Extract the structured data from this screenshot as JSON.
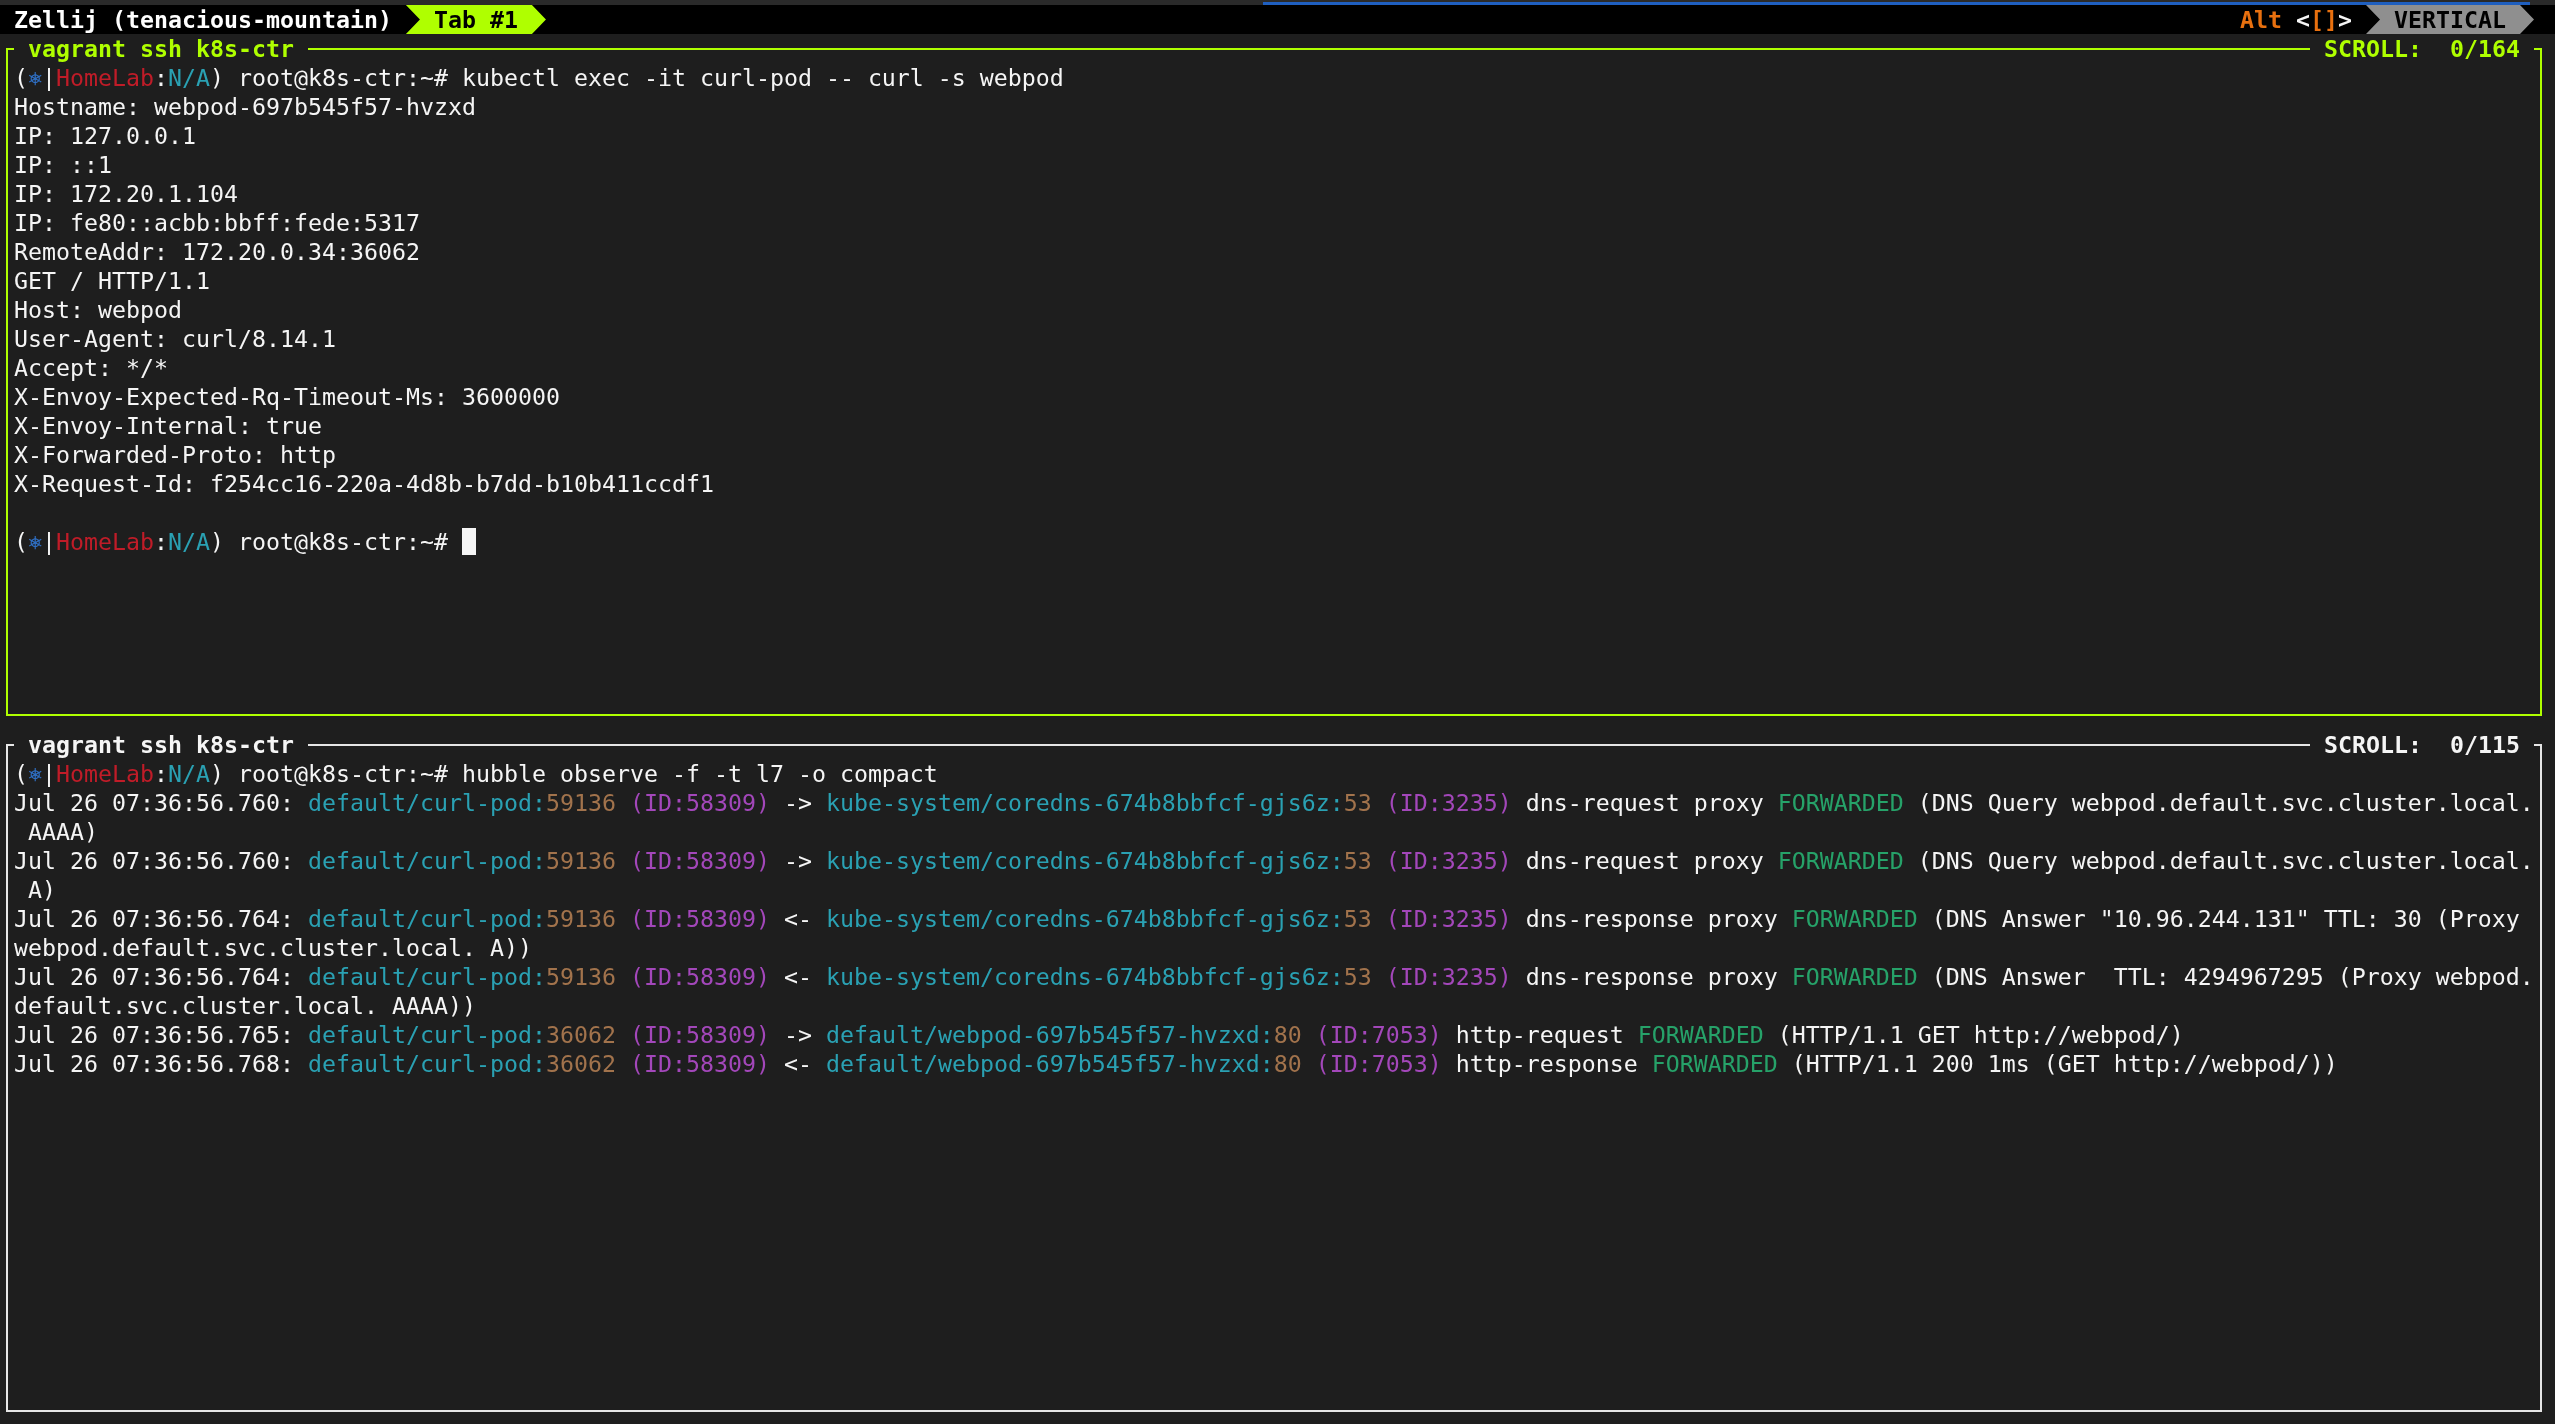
{
  "tab_bar": {
    "session": "Zellij (tenacious-mountain)",
    "tabs": [
      {
        "label": "Tab #1",
        "selected": true
      }
    ],
    "mode_hint": [
      {
        "text": "Alt",
        "kind": "key"
      },
      {
        "text": " <",
        "kind": "plain"
      },
      {
        "text": "[]",
        "kind": "key"
      },
      {
        "text": ">",
        "kind": "plain"
      }
    ],
    "layout": "VERTICAL"
  },
  "panes": [
    {
      "title": "vagrant ssh k8s-ctr",
      "scroll": "SCROLL:  0/164",
      "focused": true,
      "cursor": true,
      "lines": [
        {
          "kind": "prompt",
          "segments": [
            {
              "text": "(",
              "kind": "plain"
            },
            {
              "text": "⎈",
              "kind": "helm"
            },
            {
              "text": "|",
              "kind": "plain"
            },
            {
              "text": "HomeLab",
              "kind": "cluster"
            },
            {
              "text": ":",
              "kind": "plain"
            },
            {
              "text": "N/A",
              "kind": "namespace"
            },
            {
              "text": ") root@k8s-ctr:~# kubectl exec -it curl-pod -- curl -s webpod",
              "kind": "plain"
            }
          ]
        },
        {
          "kind": "output",
          "text": "Hostname: webpod-697b545f57-hvzxd"
        },
        {
          "kind": "output",
          "text": "IP: 127.0.0.1"
        },
        {
          "kind": "output",
          "text": "IP: ::1"
        },
        {
          "kind": "output",
          "text": "IP: 172.20.1.104"
        },
        {
          "kind": "output",
          "text": "IP: fe80::acbb:bbff:fede:5317"
        },
        {
          "kind": "output",
          "text": "RemoteAddr: 172.20.0.34:36062"
        },
        {
          "kind": "output",
          "text": "GET / HTTP/1.1"
        },
        {
          "kind": "output",
          "text": "Host: webpod"
        },
        {
          "kind": "output",
          "text": "User-Agent: curl/8.14.1"
        },
        {
          "kind": "output",
          "text": "Accept: */*"
        },
        {
          "kind": "output",
          "text": "X-Envoy-Expected-Rq-Timeout-Ms: 3600000"
        },
        {
          "kind": "output",
          "text": "X-Envoy-Internal: true"
        },
        {
          "kind": "output",
          "text": "X-Forwarded-Proto: http"
        },
        {
          "kind": "output",
          "text": "X-Request-Id: f254cc16-220a-4d8b-b7dd-b10b411ccdf1"
        },
        {
          "kind": "blank"
        },
        {
          "kind": "prompt",
          "segments": [
            {
              "text": "(",
              "kind": "plain"
            },
            {
              "text": "⎈",
              "kind": "helm"
            },
            {
              "text": "|",
              "kind": "plain"
            },
            {
              "text": "HomeLab",
              "kind": "cluster"
            },
            {
              "text": ":",
              "kind": "plain"
            },
            {
              "text": "N/A",
              "kind": "namespace"
            },
            {
              "text": ") root@k8s-ctr:~#",
              "kind": "plain"
            }
          ]
        }
      ]
    },
    {
      "title": "vagrant ssh k8s-ctr",
      "scroll": "SCROLL:  0/115",
      "focused": false,
      "cursor": false,
      "lines": [
        {
          "kind": "prompt",
          "segments": [
            {
              "text": "(",
              "kind": "plain"
            },
            {
              "text": "⎈",
              "kind": "helm"
            },
            {
              "text": "|",
              "kind": "plain"
            },
            {
              "text": "HomeLab",
              "kind": "cluster"
            },
            {
              "text": ":",
              "kind": "plain"
            },
            {
              "text": "N/A",
              "kind": "namespace"
            },
            {
              "text": ") root@k8s-ctr:~# hubble observe -f -t l7 -o compact",
              "kind": "plain"
            }
          ]
        },
        {
          "kind": "flow",
          "time": "Jul 26 07:36:56.760:",
          "source": "default/curl-pod:",
          "source_port": "59136",
          "source_id": "(ID:58309)",
          "direction": "->",
          "destination": "kube-system/coredns-674b8bbfcf-gjs6z:",
          "destination_port": "53",
          "destination_id": "(ID:3235)",
          "type": "dns-request proxy",
          "verdict": "FORWARDED",
          "summary": "(DNS Query webpod.default.svc.cluster.local. AAAA)"
        },
        {
          "kind": "flow",
          "time": "Jul 26 07:36:56.760:",
          "source": "default/curl-pod:",
          "source_port": "59136",
          "source_id": "(ID:58309)",
          "direction": "->",
          "destination": "kube-system/coredns-674b8bbfcf-gjs6z:",
          "destination_port": "53",
          "destination_id": "(ID:3235)",
          "type": "dns-request proxy",
          "verdict": "FORWARDED",
          "summary": "(DNS Query webpod.default.svc.cluster.local. A)"
        },
        {
          "kind": "flow",
          "time": "Jul 26 07:36:56.764:",
          "source": "default/curl-pod:",
          "source_port": "59136",
          "source_id": "(ID:58309)",
          "direction": "<-",
          "destination": "kube-system/coredns-674b8bbfcf-gjs6z:",
          "destination_port": "53",
          "destination_id": "(ID:3235)",
          "type": "dns-response proxy",
          "verdict": "FORWARDED",
          "summary": "(DNS Answer \"10.96.244.131\" TTL: 30 (Proxy webpod.default.svc.cluster.local. A))"
        },
        {
          "kind": "flow",
          "time": "Jul 26 07:36:56.764:",
          "source": "default/curl-pod:",
          "source_port": "59136",
          "source_id": "(ID:58309)",
          "direction": "<-",
          "destination": "kube-system/coredns-674b8bbfcf-gjs6z:",
          "destination_port": "53",
          "destination_id": "(ID:3235)",
          "type": "dns-response proxy",
          "verdict": "FORWARDED",
          "summary": "(DNS Answer  TTL: 4294967295 (Proxy webpod.default.svc.cluster.local. AAAA))"
        },
        {
          "kind": "flow",
          "time": "Jul 26 07:36:56.765:",
          "source": "default/curl-pod:",
          "source_port": "36062",
          "source_id": "(ID:58309)",
          "direction": "->",
          "destination": "default/webpod-697b545f57-hvzxd:",
          "destination_port": "80",
          "destination_id": "(ID:7053)",
          "type": "http-request",
          "verdict": "FORWARDED",
          "summary": "(HTTP/1.1 GET http://webpod/)"
        },
        {
          "kind": "flow",
          "time": "Jul 26 07:36:56.768:",
          "source": "default/curl-pod:",
          "source_port": "36062",
          "source_id": "(ID:58309)",
          "direction": "<-",
          "destination": "default/webpod-697b545f57-hvzxd:",
          "destination_port": "80",
          "destination_id": "(ID:7053)",
          "type": "http-response",
          "verdict": "FORWARDED",
          "summary": "(HTTP/1.1 200 1ms (GET http://webpod/))"
        }
      ]
    }
  ]
}
